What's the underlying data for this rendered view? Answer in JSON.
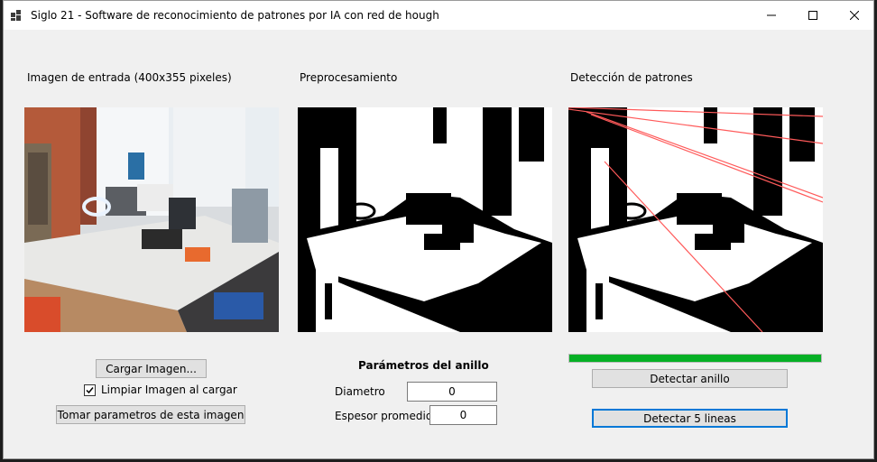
{
  "window": {
    "title": "Siglo 21 - Software de reconocimiento de patrones por IA con red de hough",
    "controls": [
      "minimize-icon",
      "maximize-icon",
      "close-icon"
    ]
  },
  "panels": {
    "input_label": "Imagen de entrada (400x355 pixeles)",
    "preprocess_label": "Preprocesamiento",
    "detection_label": "Detección de patrones"
  },
  "left_controls": {
    "load_button": "Cargar Imagen...",
    "clear_checkbox_label": "Limpiar Imagen al cargar",
    "clear_checkbox_checked": true,
    "take_params_button": "Tomar parametros de esta imagen"
  },
  "ring_params": {
    "heading": "Parámetros del anillo",
    "diameter_label": "Diametro",
    "diameter_value": "0",
    "thickness_label": "Espesor promedio",
    "thickness_value": "0"
  },
  "right_controls": {
    "progress_fraction": 1.0,
    "progress_color": "#06b025",
    "detect_ring_button": "Detectar anillo",
    "detect_lines_button": "Detectar 5  lineas"
  }
}
